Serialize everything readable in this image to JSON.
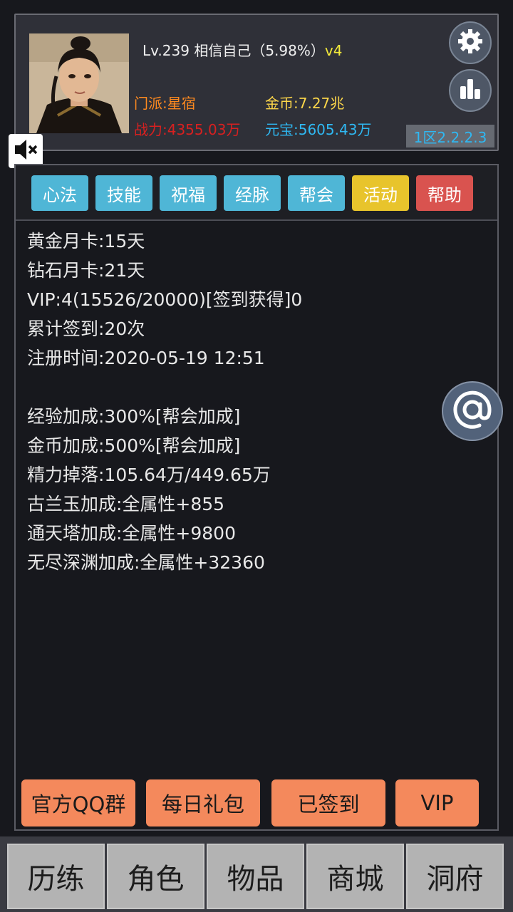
{
  "header": {
    "level_text": "Lv.239 相信自己（5.98%）",
    "vip_badge": "v4",
    "sect": "门派:星宿",
    "gold": "金币:7.27兆",
    "power": "战力:4355.03万",
    "yuanbao": "元宝:5605.43万",
    "server": "1区2.2.2.3"
  },
  "icons": {
    "settings": "gear-icon",
    "rank": "bar-chart-icon",
    "mute": "speaker-mute-icon",
    "at": "at-icon"
  },
  "tabs": [
    {
      "label": "心法",
      "color": "#4fb6d6"
    },
    {
      "label": "技能",
      "color": "#4fb6d6"
    },
    {
      "label": "祝福",
      "color": "#4fb6d6"
    },
    {
      "label": "经脉",
      "color": "#4fb6d6"
    },
    {
      "label": "帮会",
      "color": "#4fb6d6"
    },
    {
      "label": "活动",
      "color": "#e8c42c"
    },
    {
      "label": "帮助",
      "color": "#d9534f"
    }
  ],
  "info": {
    "gold_card": "黄金月卡:15天",
    "diamond_card": "钻石月卡:21天",
    "vip": "VIP:4(15526/20000)[签到获得]0",
    "checkin_total": "累计签到:20次",
    "register_time": "注册时间:2020-05-19 12:51",
    "exp_bonus": "经验加成:300%[帮会加成]",
    "gold_bonus": "金币加成:500%[帮会加成]",
    "energy_drop": "精力掉落:105.64万/449.65万",
    "gulan_bonus": "古兰玉加成:全属性+855",
    "tower_bonus": "通天塔加成:全属性+9800",
    "abyss_bonus": "无尽深渊加成:全属性+32360"
  },
  "actions": {
    "qq_group": "官方QQ群",
    "daily_gift": "每日礼包",
    "checked_in": "已签到",
    "vip": "VIP"
  },
  "nav": [
    "历练",
    "角色",
    "物品",
    "商城",
    "洞府"
  ]
}
